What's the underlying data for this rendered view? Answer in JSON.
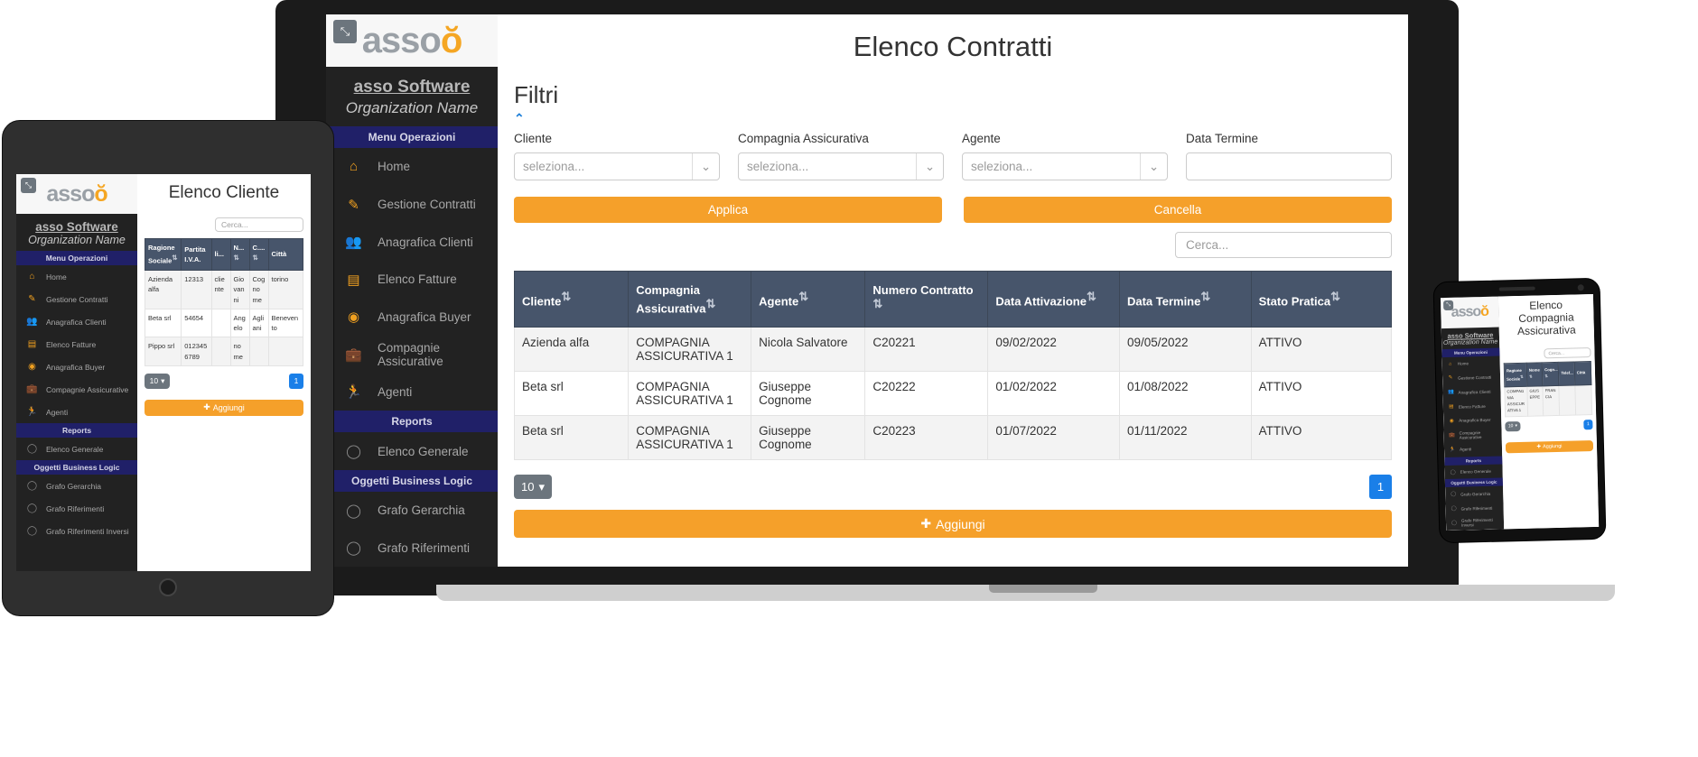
{
  "brand": {
    "logo_text": "asso",
    "name": "asso Software",
    "organization": "Organization Name"
  },
  "sidebar": {
    "sections": [
      {
        "title": "Menu Operazioni",
        "items": [
          {
            "label": "Home",
            "icon": "home-icon"
          },
          {
            "label": "Gestione Contratti",
            "icon": "edit-document-icon"
          },
          {
            "label": "Anagrafica Clienti",
            "icon": "users-icon"
          },
          {
            "label": "Elenco Fatture",
            "icon": "invoice-icon"
          },
          {
            "label": "Anagrafica Buyer",
            "icon": "user-circle-icon"
          },
          {
            "label": "Compagnie Assicurative",
            "icon": "briefcase-icon"
          },
          {
            "label": "Agenti",
            "icon": "running-person-icon"
          }
        ]
      },
      {
        "title": "Reports",
        "items": [
          {
            "label": "Elenco Generale",
            "icon": "circle-icon"
          }
        ]
      },
      {
        "title": "Oggetti Business Logic",
        "items": [
          {
            "label": "Grafo Gerarchia",
            "icon": "circle-icon"
          },
          {
            "label": "Grafo Riferimenti",
            "icon": "circle-icon"
          },
          {
            "label": "Grafo Riferimenti Inversi",
            "icon": "circle-icon"
          }
        ]
      }
    ]
  },
  "laptop": {
    "page_title": "Elenco Contratti",
    "filters": {
      "section_title": "Filtri",
      "collapse_icon": "chevron-up-icon",
      "fields": [
        {
          "label": "Cliente",
          "placeholder": "seleziona...",
          "type": "select"
        },
        {
          "label": "Compagnia Assicurativa",
          "placeholder": "seleziona...",
          "type": "select"
        },
        {
          "label": "Agente",
          "placeholder": "seleziona...",
          "type": "select"
        },
        {
          "label": "Data Termine",
          "placeholder": "",
          "type": "text"
        }
      ],
      "apply_label": "Applica",
      "clear_label": "Cancella"
    },
    "search_placeholder": "Cerca...",
    "table": {
      "columns": [
        "Cliente",
        "Compagnia Assicurativa",
        "Agente",
        "Numero Contratto",
        "Data Attivazione",
        "Data Termine",
        "Stato Pratica"
      ],
      "rows": [
        [
          "Azienda alfa",
          "COMPAGNIA ASSICURATIVA 1",
          "Nicola Salvatore",
          "C20221",
          "09/02/2022",
          "09/05/2022",
          "ATTIVO"
        ],
        [
          "Beta srl",
          "COMPAGNIA ASSICURATIVA 1",
          "Giuseppe Cognome",
          "C20222",
          "01/02/2022",
          "01/08/2022",
          "ATTIVO"
        ],
        [
          "Beta srl",
          "COMPAGNIA ASSICURATIVA 1",
          "Giuseppe Cognome",
          "C20223",
          "01/07/2022",
          "01/11/2022",
          "ATTIVO"
        ]
      ]
    },
    "page_size": "10",
    "page_number": "1",
    "add_label": "Aggiungi"
  },
  "tablet": {
    "page_title": "Elenco Cliente",
    "search_placeholder": "Cerca...",
    "table": {
      "columns": [
        "Ragione Sociale",
        "Partita I.V.A.",
        "li...",
        "N...",
        "C....",
        "Città"
      ],
      "rows": [
        [
          "Azienda alfa",
          "12313",
          "cliente",
          "Giovanni",
          "Cognome",
          "torino"
        ],
        [
          "Beta srl",
          "54654",
          "",
          "Angelo",
          "Agliani",
          "Benevento"
        ],
        [
          "Pippo srl",
          "0123456789",
          "",
          "nome",
          "",
          ""
        ]
      ]
    },
    "page_size": "10",
    "page_number": "1",
    "add_label": "Aggiungi"
  },
  "phone": {
    "page_title": "Elenco Compagnia Assicurativa",
    "search_placeholder": "Cerca...",
    "table": {
      "columns": [
        "Ragione Sociale",
        "Nome",
        "Cogn...",
        "Telef...",
        "Città"
      ],
      "rows": [
        [
          "COMPAGNIA ASSICURATIVA 1",
          "GIUSEPPE",
          "FRANCIA",
          "",
          ""
        ]
      ]
    },
    "page_size": "10",
    "page_number": "1",
    "add_label": "Aggiungi"
  },
  "colors": {
    "accent_orange": "#f5a02a",
    "sidebar_dark": "#222222",
    "section_header_blue": "#202068",
    "table_header": "#47556b",
    "page_button_blue": "#1a7fe8"
  }
}
